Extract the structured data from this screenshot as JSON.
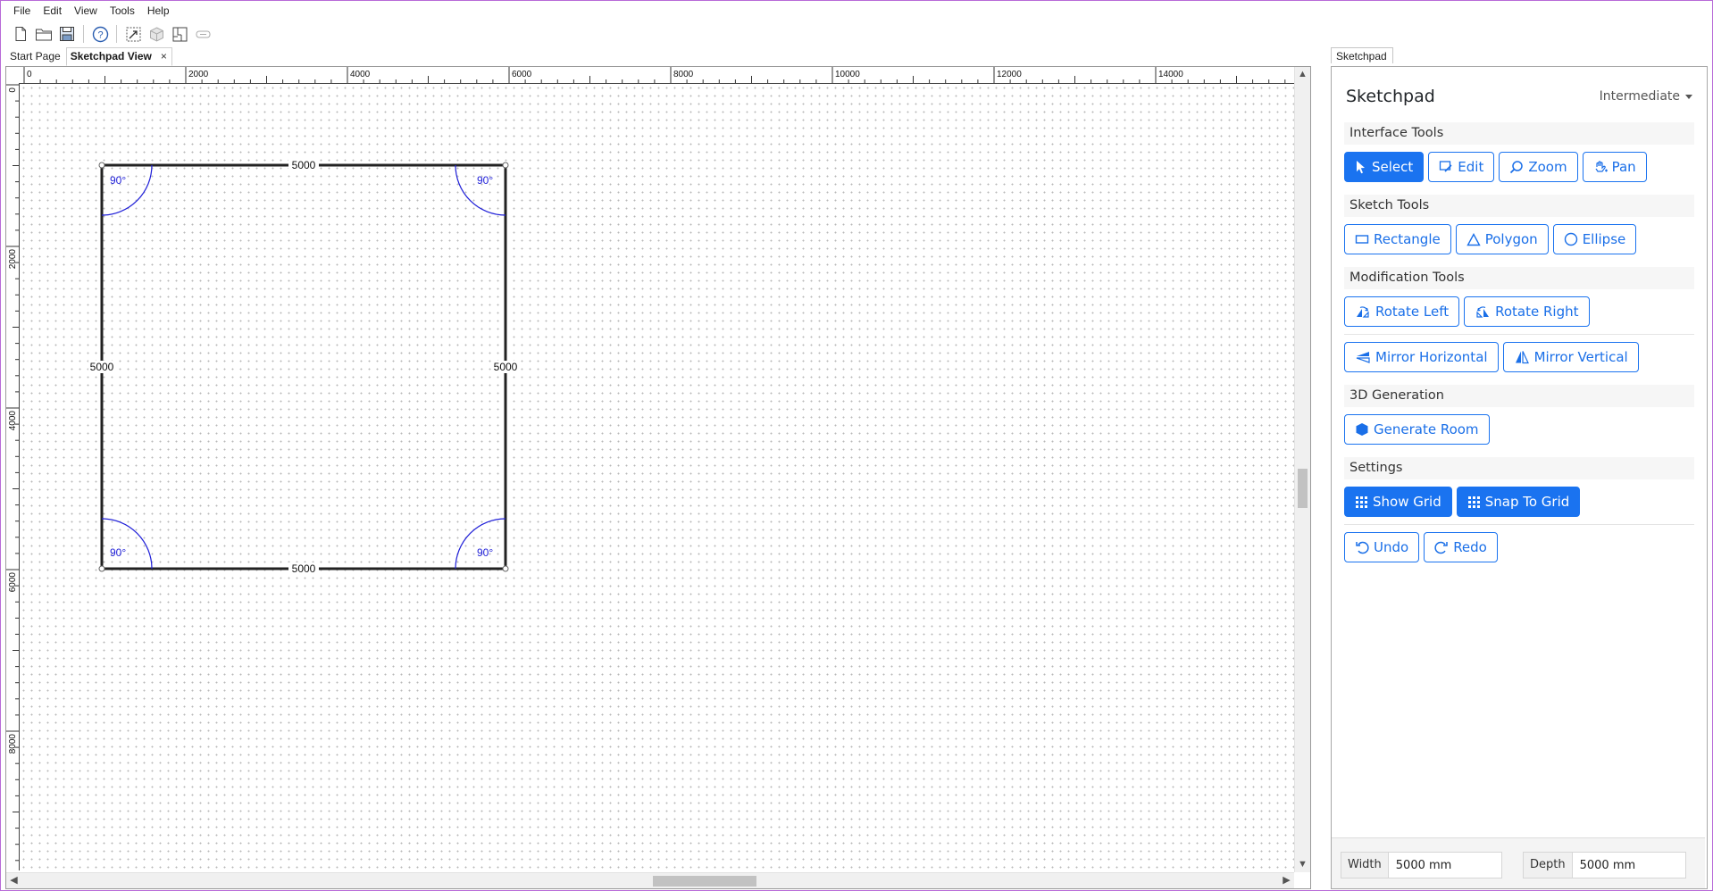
{
  "menu": [
    "File",
    "Edit",
    "View",
    "Tools",
    "Help"
  ],
  "toolbar": [
    "new-file-icon",
    "open-folder-icon",
    "save-icon",
    "help-icon",
    "select-area-icon",
    "cube-icon",
    "floorplan-icon",
    "link-icon"
  ],
  "doc_tabs": {
    "start": "Start Page",
    "sketch": "Sketchpad View",
    "close": "×"
  },
  "rulers": {
    "h_ticks": [
      "0",
      "2000",
      "4000",
      "6000",
      "8000",
      "10000",
      "12000",
      "14000"
    ],
    "v_ticks": [
      "0",
      "2000",
      "4000",
      "6000",
      "8000"
    ]
  },
  "sketch": {
    "top_len": "5000",
    "bottom_len": "5000",
    "left_len": "5000",
    "right_len": "5000",
    "angle": "90°"
  },
  "pane": {
    "tab": "Sketchpad",
    "title": "Sketchpad",
    "level": "Intermediate",
    "sections": {
      "interface": "Interface Tools",
      "sketch": "Sketch Tools",
      "modification": "Modification Tools",
      "generation": "3D Generation",
      "settings": "Settings"
    },
    "buttons": {
      "select": "Select",
      "edit": "Edit",
      "zoom": "Zoom",
      "pan": "Pan",
      "rectangle": "Rectangle",
      "polygon": "Polygon",
      "ellipse": "Ellipse",
      "rotate_left": "Rotate Left",
      "rotate_right": "Rotate Right",
      "mirror_h": "Mirror Horizontal",
      "mirror_v": "Mirror Vertical",
      "generate_room": "Generate Room",
      "show_grid": "Show Grid",
      "snap_grid": "Snap To Grid",
      "undo": "Undo",
      "redo": "Redo"
    },
    "footer": {
      "width_label": "Width",
      "width_value": "5000 mm",
      "depth_label": "Depth",
      "depth_value": "5000 mm"
    }
  },
  "colors": {
    "accent": "#1a73f0",
    "angle_arc": "#1f1fd8",
    "window_border": "#b86ad8"
  }
}
